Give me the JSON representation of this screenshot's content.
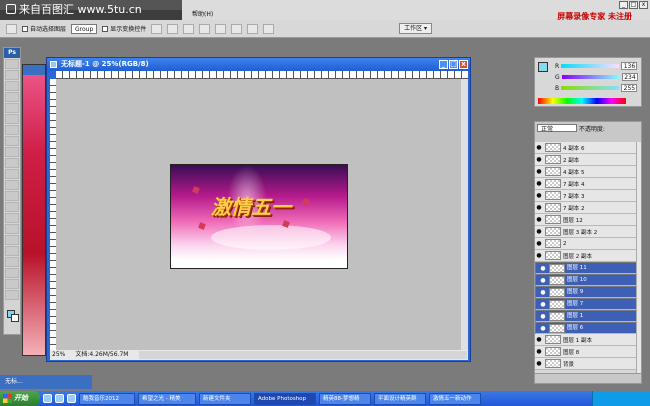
{
  "watermark": {
    "text": "来自百图汇 www.5tu.cn"
  },
  "menubar": {
    "help": "帮助(H)"
  },
  "brand": {
    "text": "屏幕录像专家 未注册"
  },
  "winctl": {
    "min": "_",
    "max": "□",
    "close": "x"
  },
  "options": {
    "auto_select": "自动选择图层",
    "group": "Group",
    "show_transform": "显示变换控件",
    "workspace": "工作区 ▾"
  },
  "toolbox": {
    "logo": "Ps"
  },
  "document": {
    "title": "无标题-1 @ 25%(RGB/8)",
    "zoom": "25%",
    "doc_size": "文档:4.26M/56.7M",
    "art_text": "激情五一"
  },
  "colorpanel": {
    "r_label": "R",
    "g_label": "G",
    "b_label": "B",
    "r": "136",
    "g": "234",
    "b": "255"
  },
  "layers": {
    "blend": "正常",
    "opacity": "不透明度:",
    "items": [
      {
        "name": "4 副本 6",
        "selected": false
      },
      {
        "name": "2 副本",
        "selected": false
      },
      {
        "name": "4 副本 5",
        "selected": false
      },
      {
        "name": "7 副本 4",
        "selected": false
      },
      {
        "name": "7 副本 3",
        "selected": false
      },
      {
        "name": "7 副本 2",
        "selected": false
      },
      {
        "name": "图层 12",
        "selected": false
      },
      {
        "name": "图层 3 副本 2",
        "selected": false
      },
      {
        "name": "2",
        "selected": false
      },
      {
        "name": "图层 2 副本",
        "selected": false
      },
      {
        "name": "图层 11",
        "selected": true
      },
      {
        "name": "图层 10",
        "selected": true
      },
      {
        "name": "图层 9",
        "selected": true
      },
      {
        "name": "图层 7",
        "selected": true
      },
      {
        "name": "图层 1",
        "selected": true
      },
      {
        "name": "图层 6",
        "selected": true
      },
      {
        "name": "图层 1 副本",
        "selected": false
      },
      {
        "name": "图层 8",
        "selected": false
      },
      {
        "name": "背景",
        "selected": false
      }
    ]
  },
  "mini": {
    "text": "无标..."
  },
  "taskbar": {
    "start": "开始",
    "clock": "",
    "tasks": [
      {
        "label": "酷我音乐2012",
        "active": false
      },
      {
        "label": "希望之光 - 精美",
        "active": false
      },
      {
        "label": "新建文件夹",
        "active": false
      },
      {
        "label": "Adobe Photoshop",
        "active": true
      },
      {
        "label": "精英88-梦想精",
        "active": false
      },
      {
        "label": "平面设计精英群",
        "active": false
      },
      {
        "label": "激情五一新动作",
        "active": false
      }
    ]
  }
}
